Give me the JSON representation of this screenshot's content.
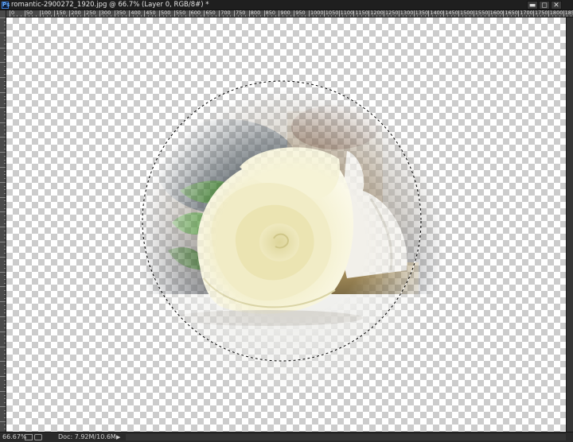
{
  "window": {
    "app_icon": "Ps",
    "title": "romantic-2900272_1920.jpg @ 66.7% (Layer 0, RGB/8#) *",
    "min_glyph": "▬",
    "max_glyph": "◻",
    "close_glyph": "✕"
  },
  "ruler": {
    "top_labels": [
      "0",
      "50",
      "100",
      "150",
      "200",
      "250",
      "300",
      "350",
      "400",
      "450",
      "500",
      "550",
      "600",
      "650",
      "700",
      "750",
      "800",
      "850",
      "900",
      "950",
      "1000",
      "1050",
      "1100",
      "1150",
      "1200",
      "1250",
      "1300",
      "1350",
      "1400",
      "1450",
      "1500",
      "1550",
      "1600",
      "1650",
      "1700",
      "1750",
      "1800",
      "1850"
    ]
  },
  "canvas": {
    "background": "transparency-checkerboard",
    "layer_content": "soft-vignetted rose photo",
    "selection": "elliptical marquee"
  },
  "status": {
    "zoom": "66.67%",
    "doc_size": "Doc: 7.92M/10.6M",
    "arrow_glyph": "▶"
  },
  "colors": {
    "chrome_dark": "#2b2b2b",
    "ruler": "#4a4a4a",
    "checker_light": "#ffffff",
    "checker_dark": "#cccccc",
    "rose_petal": "#f1edc4"
  },
  "icons": [
    "photoshop-app-icon",
    "minimize-icon",
    "maximize-icon",
    "close-icon",
    "screen-mode-icon",
    "proof-icon",
    "status-menu-arrow-icon"
  ]
}
